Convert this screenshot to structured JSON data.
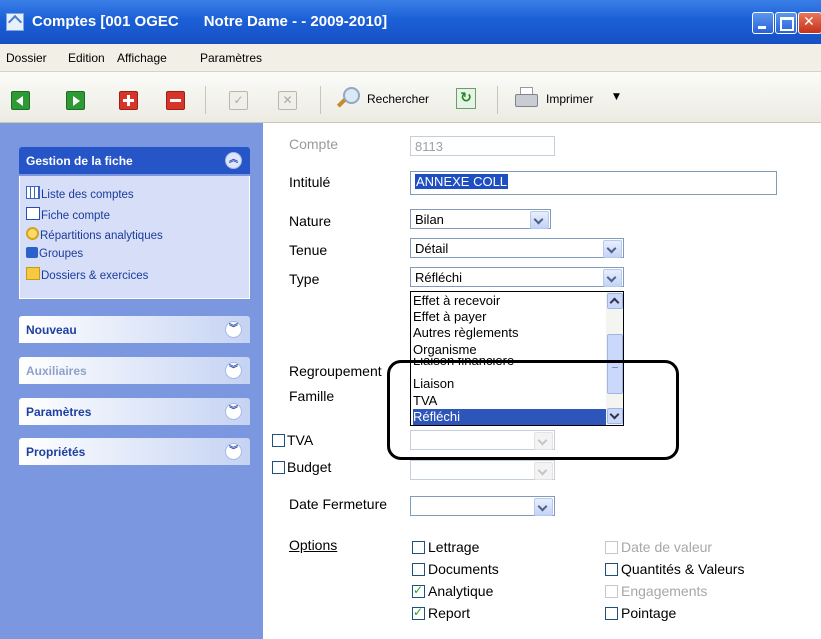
{
  "window": {
    "title": "Comptes [001 OGEC      Notre Dame - - 2009-2010]"
  },
  "menu": [
    "Dossier",
    "Edition",
    "Affichage",
    "Paramètres"
  ],
  "toolbar": {
    "search_label": "Rechercher",
    "print_label": "Imprimer"
  },
  "sidebar": {
    "sections": [
      {
        "label": "Gestion de la fiche",
        "expanded": true
      },
      {
        "label": "Nouveau"
      },
      {
        "label": "Auxiliaires"
      },
      {
        "label": "Paramètres"
      },
      {
        "label": "Propriétés"
      }
    ],
    "links": [
      "Liste des comptes",
      "Fiche compte",
      "Répartitions analytiques",
      "Groupes",
      "Dossiers & exercices"
    ]
  },
  "form": {
    "compte_label": "Compte",
    "compte_value": "8113",
    "intitule_label": "Intitulé",
    "intitule_value": "ANNEXE COLL",
    "nature_label": "Nature",
    "nature_value": "Bilan",
    "tenue_label": "Tenue",
    "tenue_value": "Détail",
    "type_label": "Type",
    "type_value": "Réfléchi",
    "regroupement_label": "Regroupement",
    "famille_label": "Famille",
    "tva_label": "TVA",
    "budget_label": "Budget",
    "date_fermeture_label": "Date Fermeture",
    "options_label": "Options"
  },
  "type_dropdown": {
    "items": [
      "Effet à recevoir",
      "Effet à payer",
      "Autres règlements",
      "Organisme",
      "Liaison financière",
      "Liaison",
      "TVA",
      "Réfléchi"
    ],
    "selected": "Réfléchi"
  },
  "options": {
    "left": [
      {
        "label": "Lettrage",
        "checked": false,
        "enabled": true
      },
      {
        "label": "Documents",
        "checked": false,
        "enabled": true
      },
      {
        "label": "Analytique",
        "checked": true,
        "enabled": true
      },
      {
        "label": "Report",
        "checked": true,
        "enabled": true
      }
    ],
    "right": [
      {
        "label": "Date de valeur",
        "checked": false,
        "enabled": false
      },
      {
        "label": "Quantités & Valeurs",
        "checked": false,
        "enabled": true
      },
      {
        "label": "Engagements",
        "checked": false,
        "enabled": false
      },
      {
        "label": "Pointage",
        "checked": false,
        "enabled": true
      }
    ]
  },
  "colors": {
    "titlebar": "#1b5fd6",
    "sidebar": "#7b97e0",
    "selection": "#2e55b9"
  }
}
